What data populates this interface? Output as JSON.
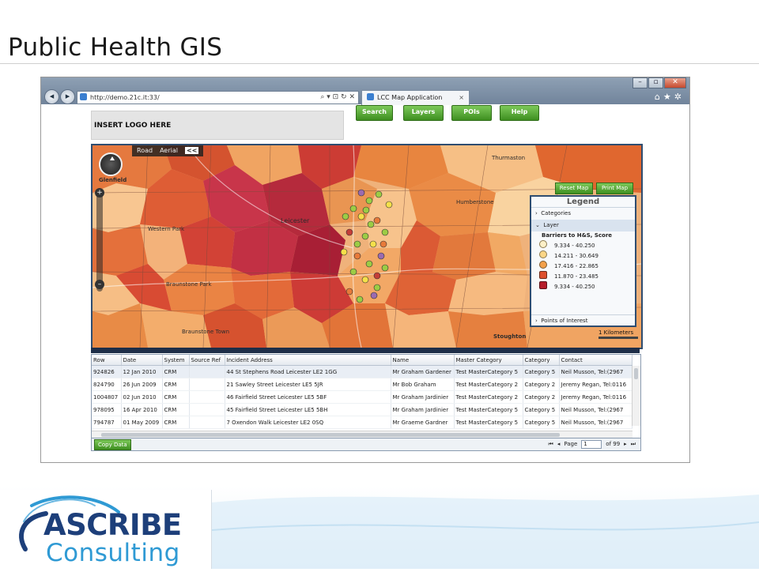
{
  "slide": {
    "title": "Public Health GIS"
  },
  "browser": {
    "url": "http://demo.21c.it:33/",
    "tab_title": "LCC Map Application",
    "tab_close": "×",
    "window_buttons": [
      "–",
      "▫",
      "✕"
    ],
    "toolbar_icons": [
      "home-icon",
      "star-icon",
      "gear-icon"
    ]
  },
  "app": {
    "logo_placeholder": "INSERT LOGO HERE",
    "buttons": [
      "Search",
      "Layers",
      "POIs",
      "Help"
    ]
  },
  "map": {
    "type_toggle": [
      "Road",
      "Aerial"
    ],
    "collapse_label": "<<",
    "zoom_in": "+",
    "zoom_out": "–",
    "labels": [
      "Glenfield",
      "Leicester",
      "Western Park",
      "Braunstone Park",
      "Stoughton",
      "Braunstone Town",
      "Thurmaston",
      "Humberstone"
    ],
    "reset_button": "Reset Map",
    "print_button": "Print Map",
    "scale_label": "1 Kilometers"
  },
  "legend": {
    "title": "Legend",
    "categories_label": "Categories",
    "layer_label": "Layer",
    "layer_name": "Barriers to H&S, Score",
    "items": [
      {
        "range": "9.334 -    40.250",
        "color": "#fdf0c8",
        "shape": "circle"
      },
      {
        "range": "14.211 -    30.649",
        "color": "#fbd687",
        "shape": "circle"
      },
      {
        "range": "17.416 -    22.865",
        "color": "#f3a04a",
        "shape": "circle"
      },
      {
        "range": "11.870 -    23.485",
        "color": "#dd4f2d",
        "shape": "hex"
      },
      {
        "range": "9.334 -    40.250",
        "color": "#b51d2a",
        "shape": "hex"
      }
    ],
    "poi_label": "Points of Interest"
  },
  "grid": {
    "columns": [
      "Row",
      "Date",
      "System",
      "Source Ref",
      "Incident Address",
      "Name",
      "Master Category",
      "Category",
      "Contact"
    ],
    "rows": [
      [
        "924826",
        "12 Jan 2010",
        "CRM",
        "",
        "44 St Stephens Road Leicester LE2 1GG",
        "Mr Graham Gardener",
        "Test MasterCategory 5",
        "Category 5",
        "Neil Musson, Tel:(2967"
      ],
      [
        "824790",
        "26 Jun 2009",
        "CRM",
        "",
        "21 Sawley Street Leicester LE5 5JR",
        "Mr Bob Graham",
        "Test MasterCategory 2",
        "Category 2",
        "Jeremy Regan, Tel:0116"
      ],
      [
        "1004807",
        "02 Jun 2010",
        "CRM",
        "",
        "46 Fairfield Street Leicester LE5 5BF",
        "Mr Graham Jardinier",
        "Test MasterCategory 2",
        "Category 2",
        "Jeremy Regan, Tel:0116"
      ],
      [
        "978095",
        "16 Apr 2010",
        "CRM",
        "",
        "45 Fairfield Street Leicester LE5 5BH",
        "Mr Graham Jardinier",
        "Test MasterCategory 5",
        "Category 5",
        "Neil Musson, Tel:(2967"
      ],
      [
        "794787",
        "01 May 2009",
        "CRM",
        "",
        "7 Oxendon Walk Leicester LE2 0SQ",
        "Mr Graeme Gardner",
        "Test MasterCategory 5",
        "Category 5",
        "Neil Musson, Tel:(2967"
      ]
    ]
  },
  "pager": {
    "copy_button": "Copy Data",
    "first": "⏮",
    "prev": "◂",
    "page_label": "Page",
    "page_value": "1",
    "of_label": "of 99",
    "next": "▸",
    "last": "⏭"
  },
  "footer": {
    "logo_text_1": "ASCRIBE",
    "logo_text_2": "Consulting"
  }
}
